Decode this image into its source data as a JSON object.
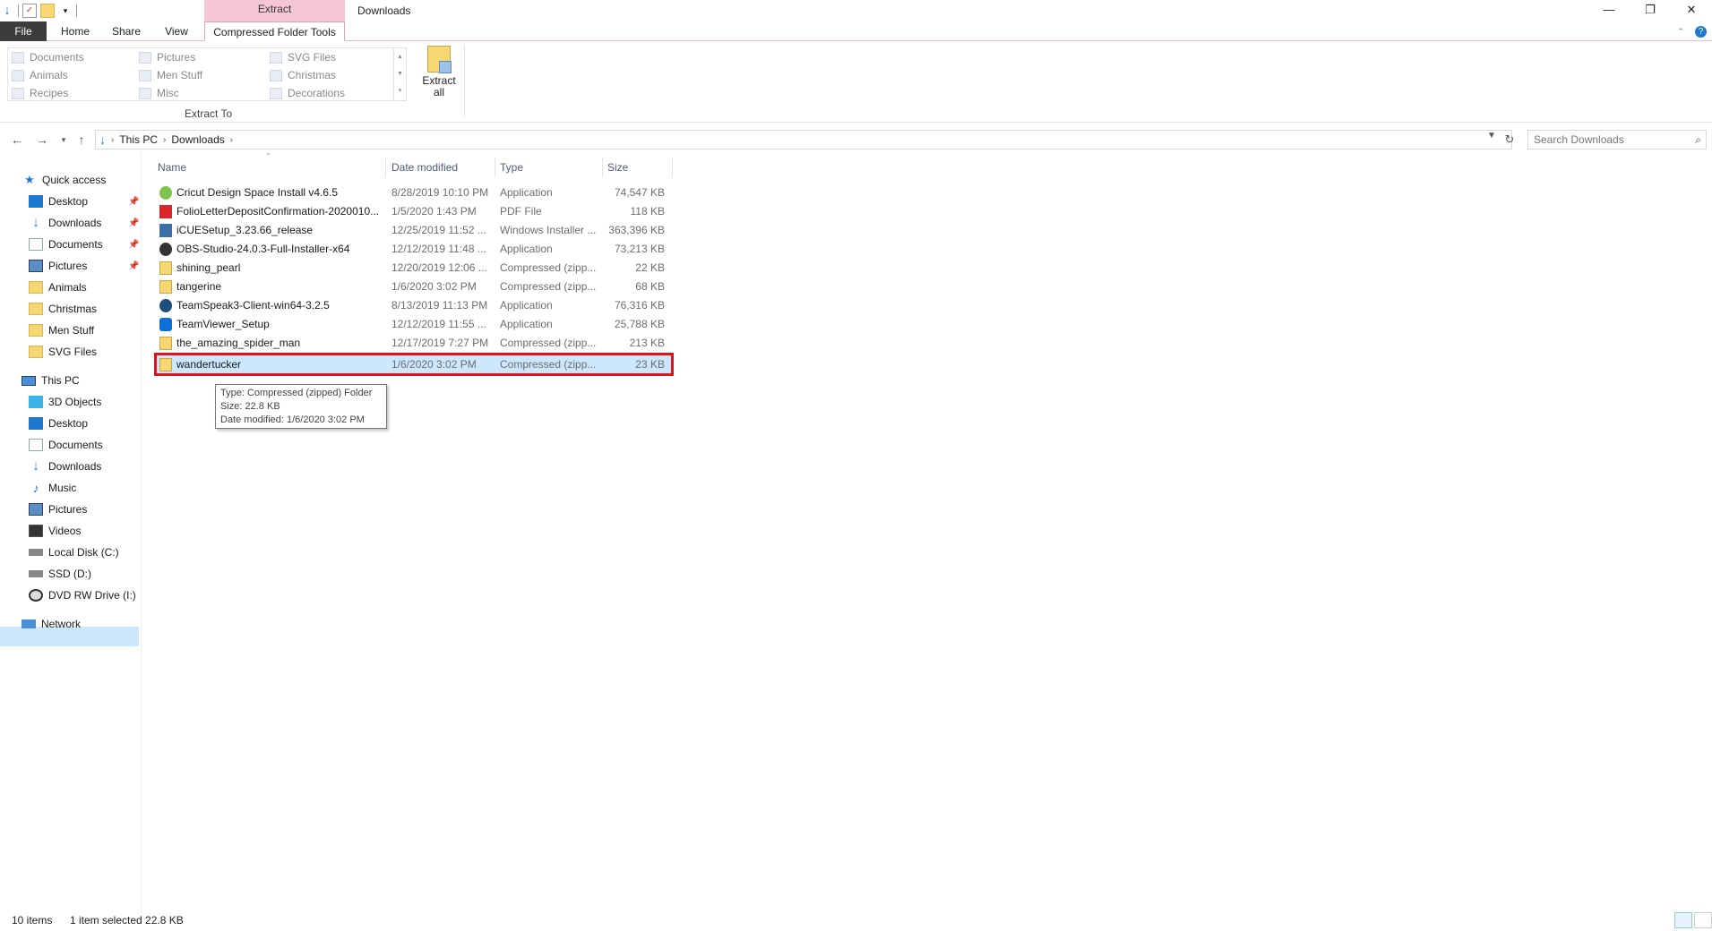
{
  "window": {
    "title": "Downloads",
    "context_tab_group": "Extract",
    "controls": {
      "minimize": "—",
      "restore": "❐",
      "close": "✕"
    }
  },
  "ribbon": {
    "tabs": [
      "File",
      "Home",
      "Share",
      "View",
      "Compressed Folder Tools"
    ],
    "active_tab": "Compressed Folder Tools",
    "extract_to_items": [
      {
        "label": "Documents"
      },
      {
        "label": "Pictures"
      },
      {
        "label": "SVG Files"
      },
      {
        "label": "Animals"
      },
      {
        "label": "Men Stuff"
      },
      {
        "label": "Christmas"
      },
      {
        "label": "Recipes"
      },
      {
        "label": "Misc"
      },
      {
        "label": "Decorations"
      }
    ],
    "extract_to_label": "Extract To",
    "extract_all_label_1": "Extract",
    "extract_all_label_2": "all"
  },
  "address": {
    "crumbs": [
      "This PC",
      "Downloads"
    ],
    "search_placeholder": "Search Downloads"
  },
  "nav": {
    "quick_access": "Quick access",
    "quick_items": [
      {
        "label": "Desktop",
        "pinned": true
      },
      {
        "label": "Downloads",
        "pinned": true
      },
      {
        "label": "Documents",
        "pinned": true
      },
      {
        "label": "Pictures",
        "pinned": true
      },
      {
        "label": "Animals",
        "pinned": false
      },
      {
        "label": "Christmas",
        "pinned": false
      },
      {
        "label": "Men Stuff",
        "pinned": false
      },
      {
        "label": "SVG Files",
        "pinned": false
      }
    ],
    "this_pc": "This PC",
    "pc_items": [
      {
        "label": "3D Objects"
      },
      {
        "label": "Desktop"
      },
      {
        "label": "Documents"
      },
      {
        "label": "Downloads"
      },
      {
        "label": "Music"
      },
      {
        "label": "Pictures"
      },
      {
        "label": "Videos"
      },
      {
        "label": "Local Disk (C:)"
      },
      {
        "label": "SSD (D:)"
      },
      {
        "label": "DVD RW Drive (I:) R("
      }
    ],
    "network": "Network",
    "selected": "Downloads"
  },
  "columns": {
    "name": "Name",
    "date": "Date modified",
    "type": "Type",
    "size": "Size"
  },
  "files": [
    {
      "name": "Cricut Design Space Install v4.6.5",
      "date": "8/28/2019 10:10 PM",
      "type": "Application",
      "size": "74,547 KB",
      "icon": "app-icon"
    },
    {
      "name": "FolioLetterDepositConfirmation-2020010...",
      "date": "1/5/2020 1:43 PM",
      "type": "PDF File",
      "size": "118 KB",
      "icon": "pdf-icon"
    },
    {
      "name": "iCUESetup_3.23.66_release",
      "date": "12/25/2019 11:52 ...",
      "type": "Windows Installer ...",
      "size": "363,396 KB",
      "icon": "installer-icon"
    },
    {
      "name": "OBS-Studio-24.0.3-Full-Installer-x64",
      "date": "12/12/2019 11:48 ...",
      "type": "Application",
      "size": "73,213 KB",
      "icon": "obs-icon"
    },
    {
      "name": "shining_pearl",
      "date": "12/20/2019 12:06 ...",
      "type": "Compressed (zipp...",
      "size": "22 KB",
      "icon": "zip-icon"
    },
    {
      "name": "tangerine",
      "date": "1/6/2020 3:02 PM",
      "type": "Compressed (zipp...",
      "size": "68 KB",
      "icon": "zip-icon"
    },
    {
      "name": "TeamSpeak3-Client-win64-3.2.5",
      "date": "8/13/2019 11:13 PM",
      "type": "Application",
      "size": "76,316 KB",
      "icon": "teamspeak-icon"
    },
    {
      "name": "TeamViewer_Setup",
      "date": "12/12/2019 11:55 ...",
      "type": "Application",
      "size": "25,788 KB",
      "icon": "teamviewer-icon"
    },
    {
      "name": "the_amazing_spider_man",
      "date": "12/17/2019 7:27 PM",
      "type": "Compressed (zipp...",
      "size": "213 KB",
      "icon": "zip-icon"
    },
    {
      "name": "wandertucker",
      "date": "1/6/2020 3:02 PM",
      "type": "Compressed (zipp...",
      "size": "23 KB",
      "icon": "zip-icon",
      "selected": true
    }
  ],
  "tooltip": {
    "line1": "Type: Compressed (zipped) Folder",
    "line2": "Size: 22.8 KB",
    "line3": "Date modified: 1/6/2020 3:02 PM"
  },
  "status": {
    "items": "10 items",
    "selection": "1 item selected  22.8 KB"
  },
  "colors": {
    "accent": "#1e78d0",
    "selection": "#cce8ff",
    "context_tab": "#f4c6d7",
    "highlight_box": "#e0131a"
  }
}
